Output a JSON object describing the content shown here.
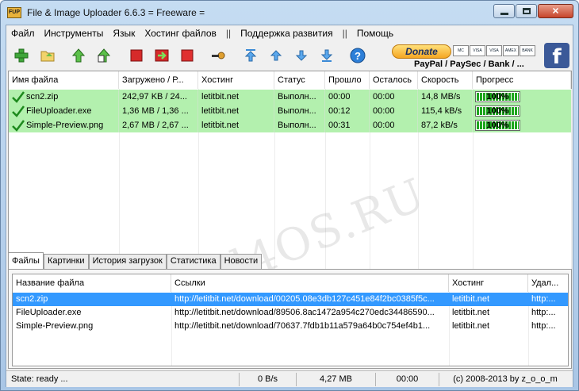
{
  "window": {
    "icon_text": "FUP",
    "title": "File & Image Uploader 6.6.3  = Freeware ="
  },
  "menu": {
    "items": [
      "Файл",
      "Инструменты",
      "Язык",
      "Хостинг файлов",
      "||",
      "Поддержка развития",
      "||",
      "Помощь"
    ]
  },
  "toolbar": {
    "icons": [
      "add-icon",
      "open-folder-icon",
      "upload-up-icon",
      "upload-all-icon",
      "stop-icon",
      "resume-icon",
      "stop-all-icon",
      "key-icon",
      "move-top-icon",
      "move-up-icon",
      "move-down-icon",
      "move-bottom-icon",
      "help-icon"
    ],
    "donate_label": "Donate",
    "pay_cards": [
      "MC",
      "VISA",
      "VISA",
      "AMEX",
      "BANK"
    ],
    "payment_methods": "PayPal / PaySec / Bank / ...",
    "facebook_label": "f"
  },
  "uploads": {
    "headers": [
      "Имя файла",
      "Загружено / Р...",
      "Хостинг",
      "Статус",
      "Прошло",
      "Осталось",
      "Скорость",
      "Прогресс"
    ],
    "rows": [
      {
        "name": "scn2.zip",
        "loaded": "242,97 KB / 24...",
        "host": "letitbit.net",
        "status": "Выполн...",
        "elapsed": "00:00",
        "remaining": "00:00",
        "speed": "14,8 MB/s",
        "progress": "100%",
        "progress_value": 1.0
      },
      {
        "name": "FileUploader.exe",
        "loaded": "1,36 MB / 1,36 ...",
        "host": "letitbit.net",
        "status": "Выполн...",
        "elapsed": "00:12",
        "remaining": "00:00",
        "speed": "115,4 kB/s",
        "progress": "100%",
        "progress_value": 1.0
      },
      {
        "name": "Simple-Preview.png",
        "loaded": "2,67 MB / 2,67 ...",
        "host": "letitbit.net",
        "status": "Выполн...",
        "elapsed": "00:31",
        "remaining": "00:00",
        "speed": "87,2 kB/s",
        "progress": "100%",
        "progress_value": 1.0
      }
    ]
  },
  "watermark": "All4OS.RU",
  "tabs": [
    "Файлы",
    "Картинки",
    "История загрузок",
    "Статистика",
    "Новости"
  ],
  "links": {
    "headers": [
      "Название файла",
      "Ссылки",
      "Хостинг",
      "Удал..."
    ],
    "rows": [
      {
        "name": "scn2.zip",
        "link": "http://letitbit.net/download/00205.08e3db127c451e84f2bc0385f5c...",
        "host": "letitbit.net",
        "delete": "http:..."
      },
      {
        "name": "FileUploader.exe",
        "link": "http://letitbit.net/download/89506.8ac1472a954c270edc34486590...",
        "host": "letitbit.net",
        "delete": "http:..."
      },
      {
        "name": "Simple-Preview.png",
        "link": "http://letitbit.net/download/70637.7fdb1b11a579a64b0c754ef4b1...",
        "host": "letitbit.net",
        "delete": "http:..."
      }
    ]
  },
  "status": {
    "state": "State: ready ...",
    "speed": "0 B/s",
    "total": "4,27 MB",
    "time": "00:00",
    "copyright": "(c) 2008-2013 by z_o_o_m"
  },
  "colors": {
    "row_done": "#b3f0ae",
    "selection": "#3399ff",
    "progress_fill": "#1ea51e"
  }
}
